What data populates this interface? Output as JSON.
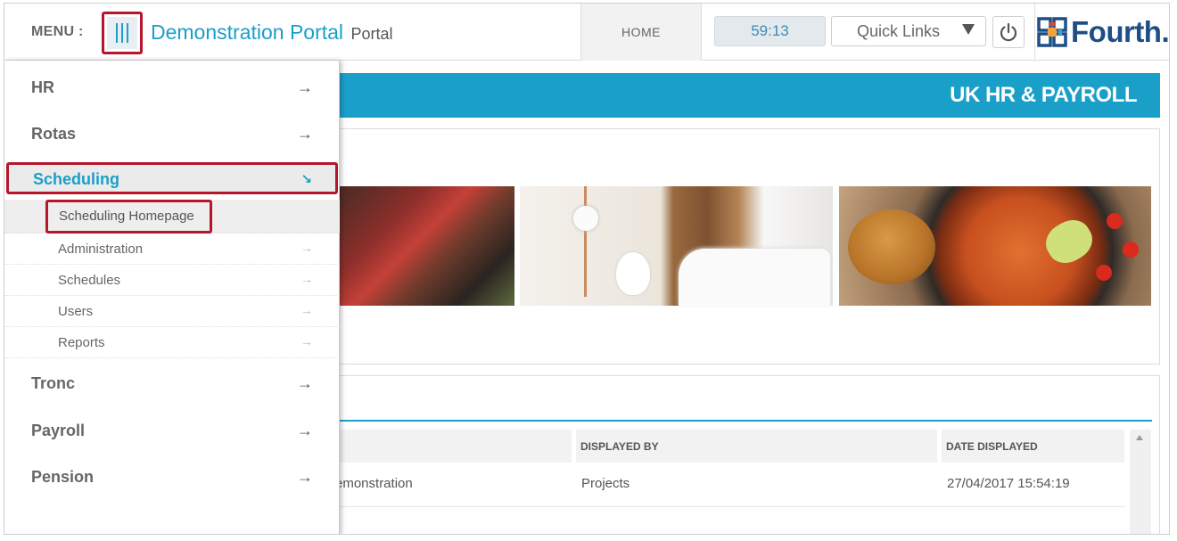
{
  "header": {
    "menu_label": "MENU :",
    "portal_title": "Demonstration Portal",
    "portal_suffix": "Portal",
    "home_tab": "HOME",
    "session_timer": "59:13",
    "quick_links": "Quick Links",
    "logo_text": "Fourth."
  },
  "banner": {
    "title": "UK HR & PAYROLL"
  },
  "side_menu": {
    "items": [
      {
        "label": "HR",
        "arrow": "→"
      },
      {
        "label": "Rotas",
        "arrow": "→"
      },
      {
        "label": "Scheduling",
        "arrow": "↘"
      },
      {
        "label": "Tronc",
        "arrow": "→"
      },
      {
        "label": "Payroll",
        "arrow": "→"
      },
      {
        "label": "Pension",
        "arrow": "→"
      }
    ],
    "scheduling_sub": [
      {
        "label": "Scheduling Homepage"
      },
      {
        "label": "Administration",
        "arrow": "→"
      },
      {
        "label": "Schedules",
        "arrow": "→"
      },
      {
        "label": "Users",
        "arrow": "→"
      },
      {
        "label": "Reports",
        "arrow": "→"
      }
    ]
  },
  "table": {
    "headers": [
      "",
      "DISPLAYED BY",
      "DATE DISPLAYED"
    ],
    "rows": [
      [
        "emonstration",
        "Projects",
        "27/04/2017 15:54:19"
      ]
    ]
  },
  "colors": {
    "accent": "#1a9fc9",
    "highlight_border": "#b5162b",
    "logo": "#1d4f86"
  },
  "icons": [
    "menu-bars-icon",
    "dropdown-caret-icon",
    "power-icon",
    "fourth-logo-icon",
    "arrow-right-icon",
    "arrow-down-right-icon",
    "scroll-up-icon"
  ]
}
